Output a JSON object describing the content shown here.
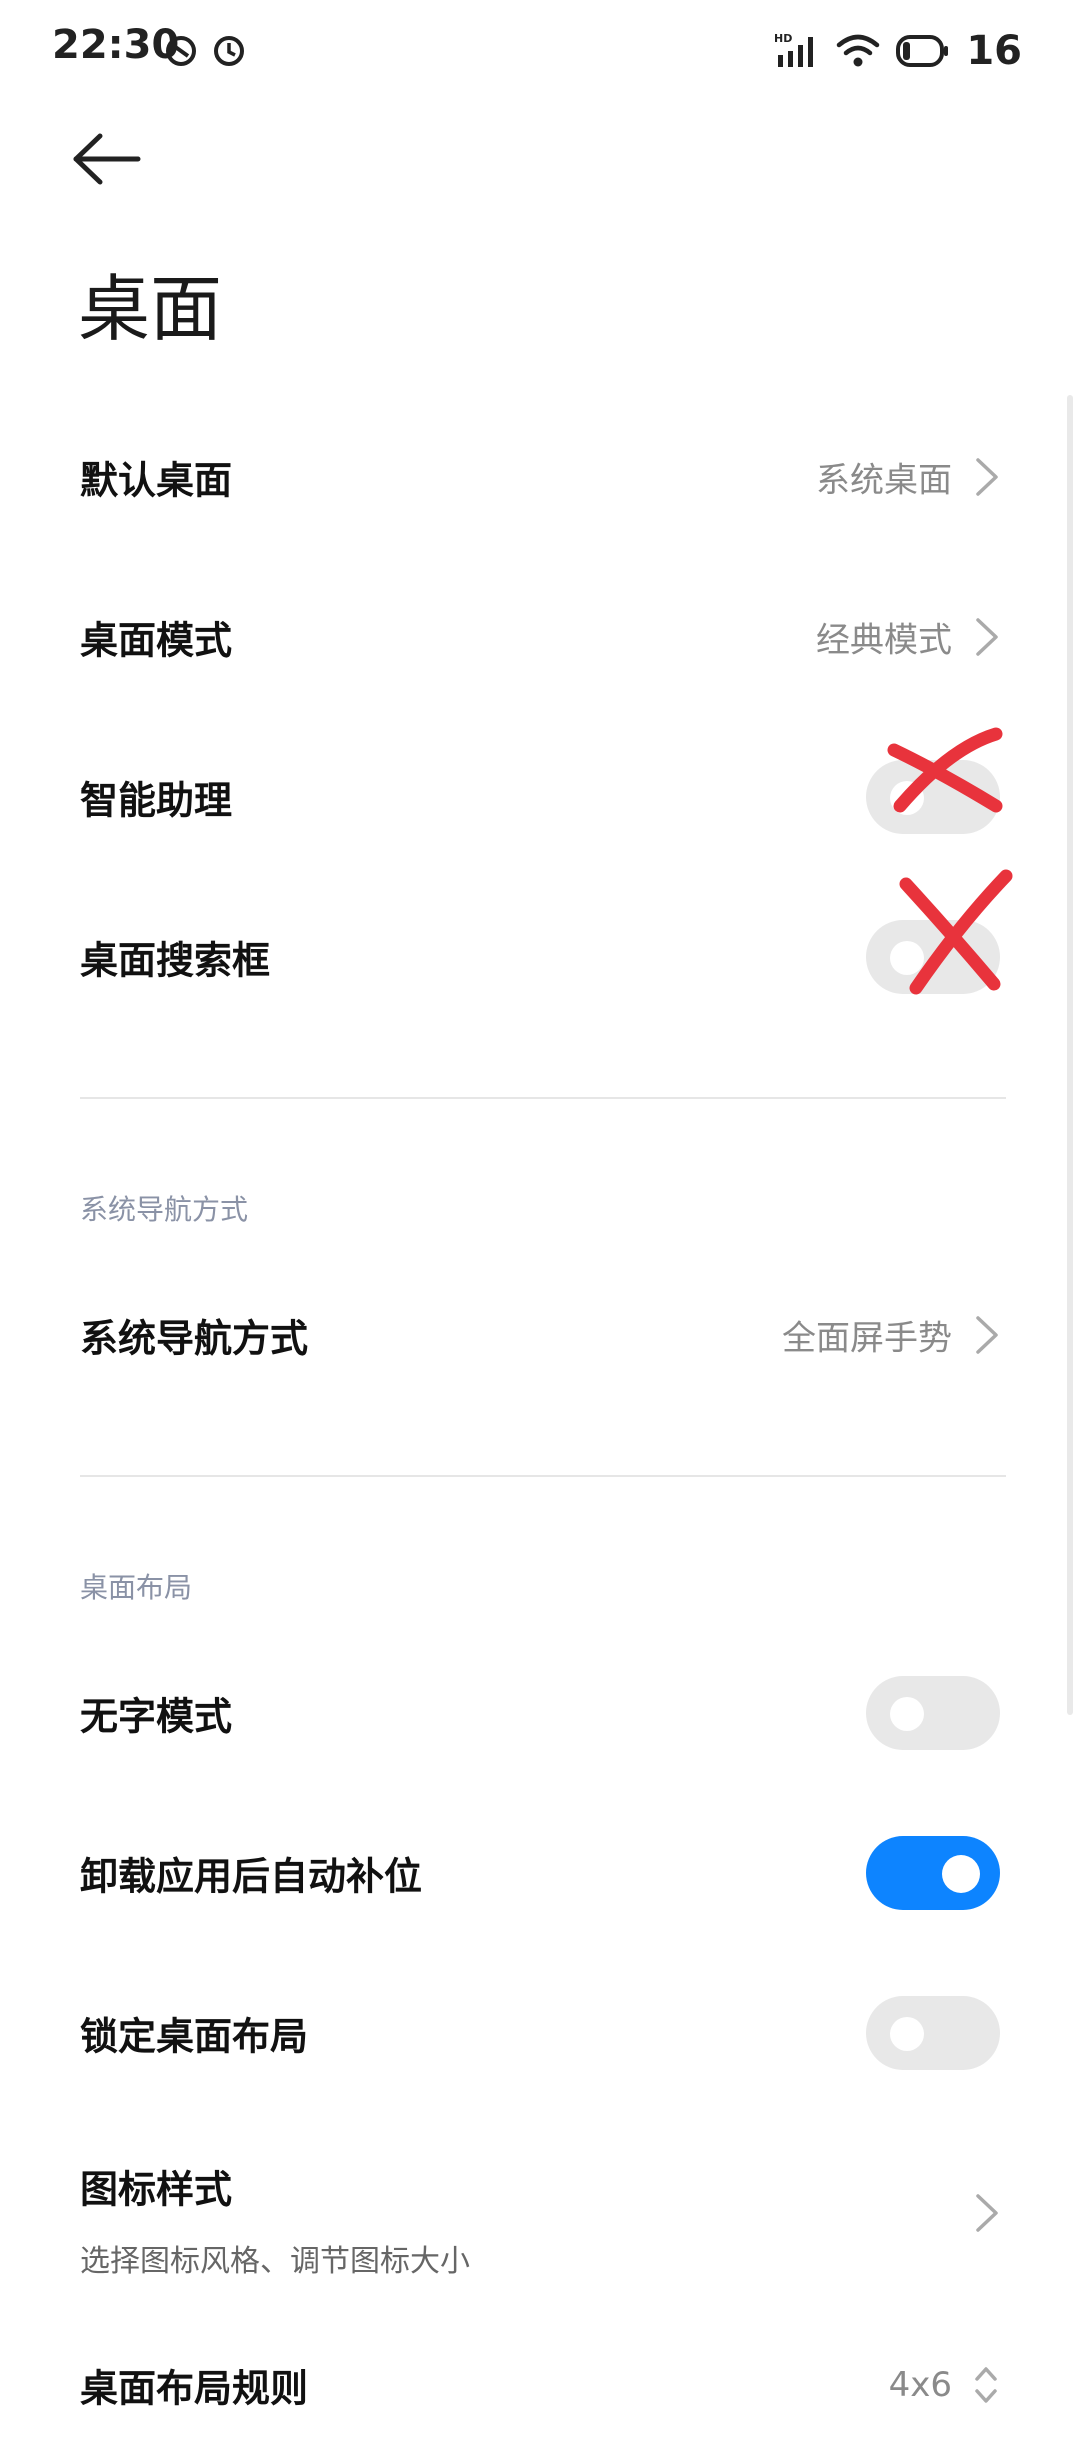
{
  "status_bar": {
    "time": "22:30",
    "left_icons": [
      "do-not-disturb-icon",
      "alarm-clock-icon"
    ],
    "right_icons": [
      "hd-signal-icon",
      "wifi-icon",
      "battery-icon"
    ],
    "battery": "16"
  },
  "header": {
    "back_icon": "back-arrow-icon",
    "title": "桌面"
  },
  "rows": [
    {
      "label": "默认桌面",
      "value": "系统桌面"
    },
    {
      "label": "桌面模式",
      "value": "经典模式"
    },
    {
      "label": "智能助理",
      "toggle": false
    },
    {
      "label": "桌面搜索框",
      "toggle": false
    }
  ],
  "sections": {
    "navigation": {
      "header": "系统导航方式",
      "row": {
        "label": "系统导航方式",
        "value": "全面屏手势"
      }
    },
    "layout": {
      "header": "桌面布局",
      "rows": [
        {
          "label": "无字模式",
          "toggle": false
        },
        {
          "label": "卸载应用后自动补位",
          "toggle": true
        },
        {
          "label": "锁定桌面布局",
          "toggle": false
        },
        {
          "label": "图标样式",
          "subtitle": "选择图标风格、调节图标大小"
        },
        {
          "label": "桌面布局规则",
          "value": "4x6"
        }
      ]
    }
  },
  "colors": {
    "accent": "#0d84ff",
    "annotation_cross": "#e8333c",
    "toggle_off": "#e8e8e8",
    "section_header": "#8a92a6"
  }
}
